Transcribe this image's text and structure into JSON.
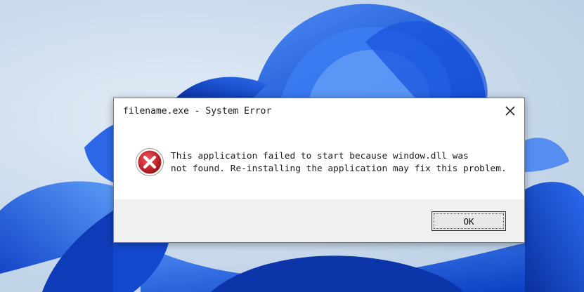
{
  "dialog": {
    "title": "filename.exe - System Error",
    "message_line1": "This application failed to start because window.dll was",
    "message_line2": "not found. Re-installing the application may fix this problem.",
    "ok_label": "OK",
    "close_icon": "close-icon",
    "status_icon": "error-icon"
  },
  "colors": {
    "wallpaper_accent": "#1a5fe0",
    "error_red": "#c8262e"
  }
}
